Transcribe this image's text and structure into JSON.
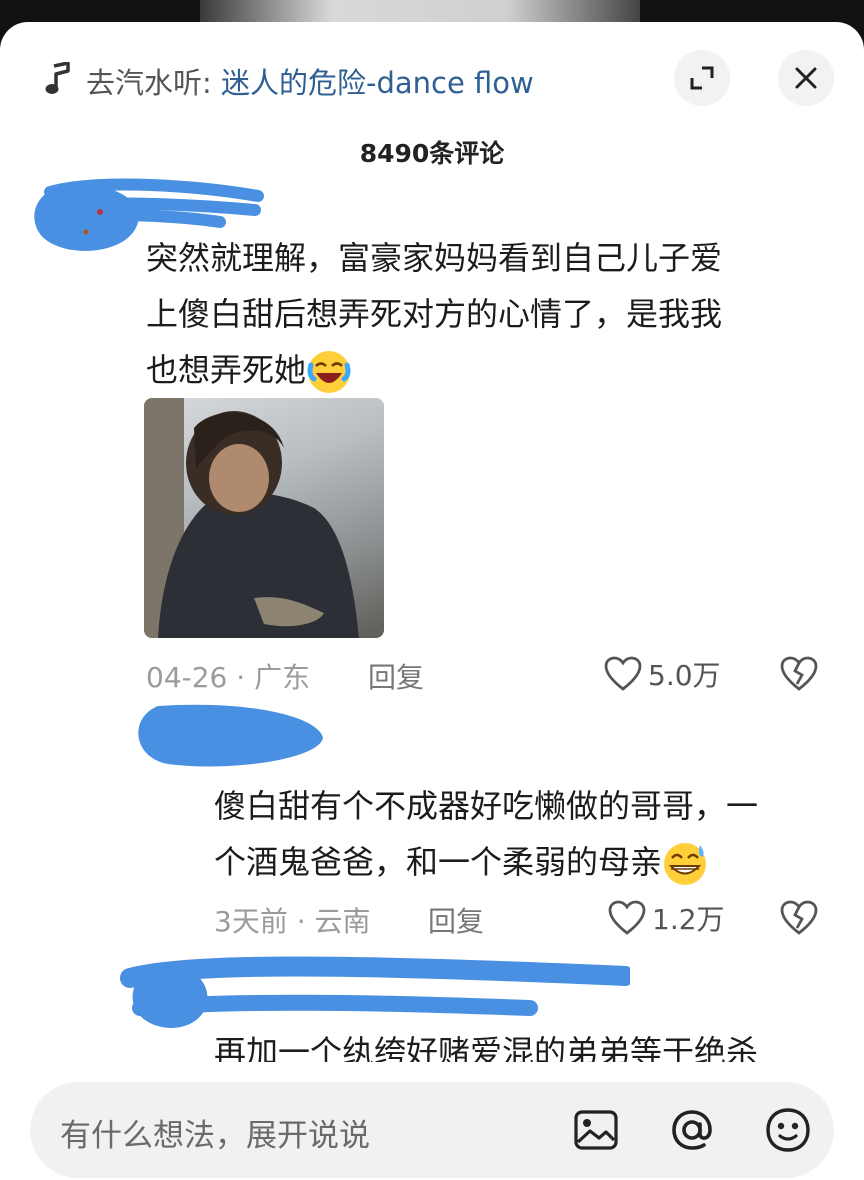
{
  "header": {
    "prefix": "去汽水听: ",
    "song": "迷人的危险-dance flow",
    "comment_count": "8490条评论"
  },
  "comments": [
    {
      "lines": [
        "突然就理解，富豪家妈妈看到自己儿子爱",
        "上傻白甜后想弄死对方的心情了，是我我",
        "也想弄死她"
      ],
      "date_region": "04-26 · 广东",
      "reply": "回复",
      "likes": "5.0万",
      "emoji": "laughing-crying-emoji"
    },
    {
      "lines": [
        "傻白甜有个不成器好吃懒做的哥哥，一",
        "个酒鬼爸爸，和一个柔弱的母亲"
      ],
      "date_region": "3天前 · 云南",
      "reply": "回复",
      "likes": "1.2万",
      "emoji": "sweat-grin-emoji"
    },
    {
      "lines": [
        "再加一个纨绔好赌爱混的弟弟等于绝杀"
      ]
    }
  ],
  "input": {
    "placeholder": "有什么想法，展开说说"
  },
  "icons": [
    "music-note-icon",
    "expand-icon",
    "close-icon",
    "heart-icon",
    "broken-heart-icon",
    "image-icon",
    "at-icon",
    "emoji-icon"
  ],
  "colors": {
    "song_link": "#2f5f93",
    "scribble": "#4a90e2"
  }
}
